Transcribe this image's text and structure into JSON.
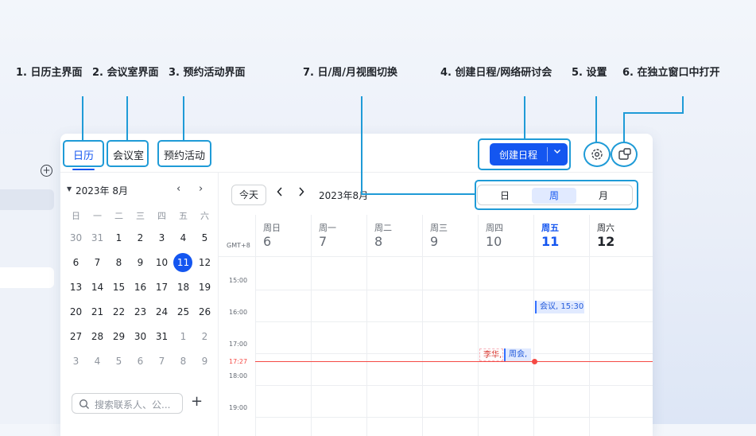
{
  "annotations": [
    {
      "label": "1. 日历主界面"
    },
    {
      "label": "2. 会议室界面"
    },
    {
      "label": "3. 预约活动界面"
    },
    {
      "label": "7. 日/周/月视图切换"
    },
    {
      "label": "4. 创建日程/网络研讨会"
    },
    {
      "label": "5. 设置"
    },
    {
      "label": "6. 在独立窗口中打开"
    }
  ],
  "tabs": [
    {
      "label": "日历"
    },
    {
      "label": "会议室"
    },
    {
      "label": "预约活动"
    }
  ],
  "toolbar": {
    "create_label": "创建日程"
  },
  "mini_calendar": {
    "title": "2023年 8月",
    "weekdays": [
      "日",
      "一",
      "二",
      "三",
      "四",
      "五",
      "六"
    ],
    "weeks": [
      [
        "30",
        "31",
        "1",
        "2",
        "3",
        "4",
        "5"
      ],
      [
        "6",
        "7",
        "8",
        "9",
        "10",
        "11",
        "12"
      ],
      [
        "13",
        "14",
        "15",
        "16",
        "17",
        "18",
        "19"
      ],
      [
        "20",
        "21",
        "22",
        "23",
        "24",
        "25",
        "26"
      ],
      [
        "27",
        "28",
        "29",
        "30",
        "31",
        "1",
        "2"
      ],
      [
        "3",
        "4",
        "5",
        "6",
        "7",
        "8",
        "9"
      ]
    ],
    "today": "11"
  },
  "search": {
    "placeholder": "搜索联系人、公..."
  },
  "calendar": {
    "today_label": "今天",
    "current_month": "2023年8月",
    "views": [
      {
        "label": "日"
      },
      {
        "label": "周"
      },
      {
        "label": "月"
      }
    ],
    "active_view": "周",
    "timezone": "GMT+8",
    "days": [
      {
        "weekday": "周日",
        "date": "6"
      },
      {
        "weekday": "周一",
        "date": "7"
      },
      {
        "weekday": "周二",
        "date": "8"
      },
      {
        "weekday": "周三",
        "date": "9"
      },
      {
        "weekday": "周四",
        "date": "10"
      },
      {
        "weekday": "周五",
        "date": "11"
      },
      {
        "weekday": "周六",
        "date": "12"
      }
    ],
    "times": [
      "15:00",
      "16:00",
      "17:00",
      "18:00",
      "19:00"
    ],
    "now_time": "17:27",
    "events": [
      {
        "title": "会议, 15:30"
      },
      {
        "title": "李华,"
      },
      {
        "title": "周会,"
      }
    ]
  },
  "colors": {
    "accent": "#1456f0",
    "annotation": "#1f9bd7",
    "now": "#f54a45"
  }
}
